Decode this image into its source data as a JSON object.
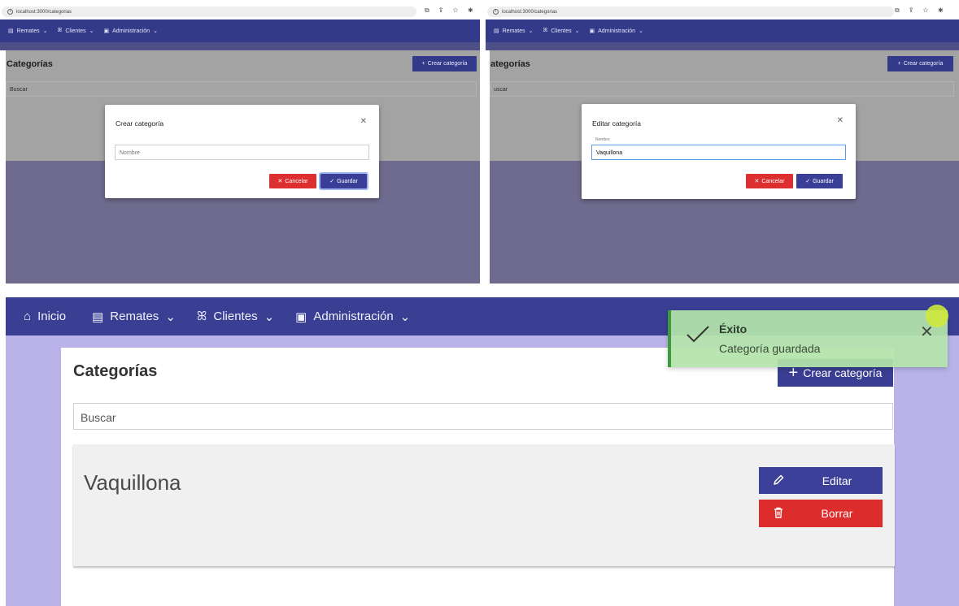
{
  "browser": {
    "url": "localhost:3000/categorias",
    "toolbar_icons": "⧉ ⇪ ☆ ✱"
  },
  "nav": {
    "home": "Inicio",
    "remates": "Remates",
    "clientes": "Clientes",
    "admin": "Administración"
  },
  "page": {
    "title": "Categorías",
    "title_cropped": "ategorías",
    "create_label": "Crear categoría",
    "search_placeholder": "Buscar",
    "search_placeholder_cropped": "uscar"
  },
  "create_modal": {
    "title": "Crear categoría",
    "name_placeholder": "Nombre",
    "cancel": "Cancelar",
    "save": "Guardar"
  },
  "edit_modal": {
    "title": "Editar categoría",
    "name_label": "Nombre",
    "name_value": "Vaquillona",
    "cancel": "Cancelar",
    "save": "Guardar"
  },
  "list": {
    "items": [
      {
        "name": "Vaquillona",
        "edit": "Editar",
        "delete": "Borrar"
      }
    ]
  },
  "toast": {
    "title": "Éxito",
    "message": "Categoría guardada"
  },
  "colors": {
    "primary": "#3b3f94",
    "danger": "#dd2f2f",
    "success": "#3f9a3c",
    "background": "#b9b3ea"
  }
}
